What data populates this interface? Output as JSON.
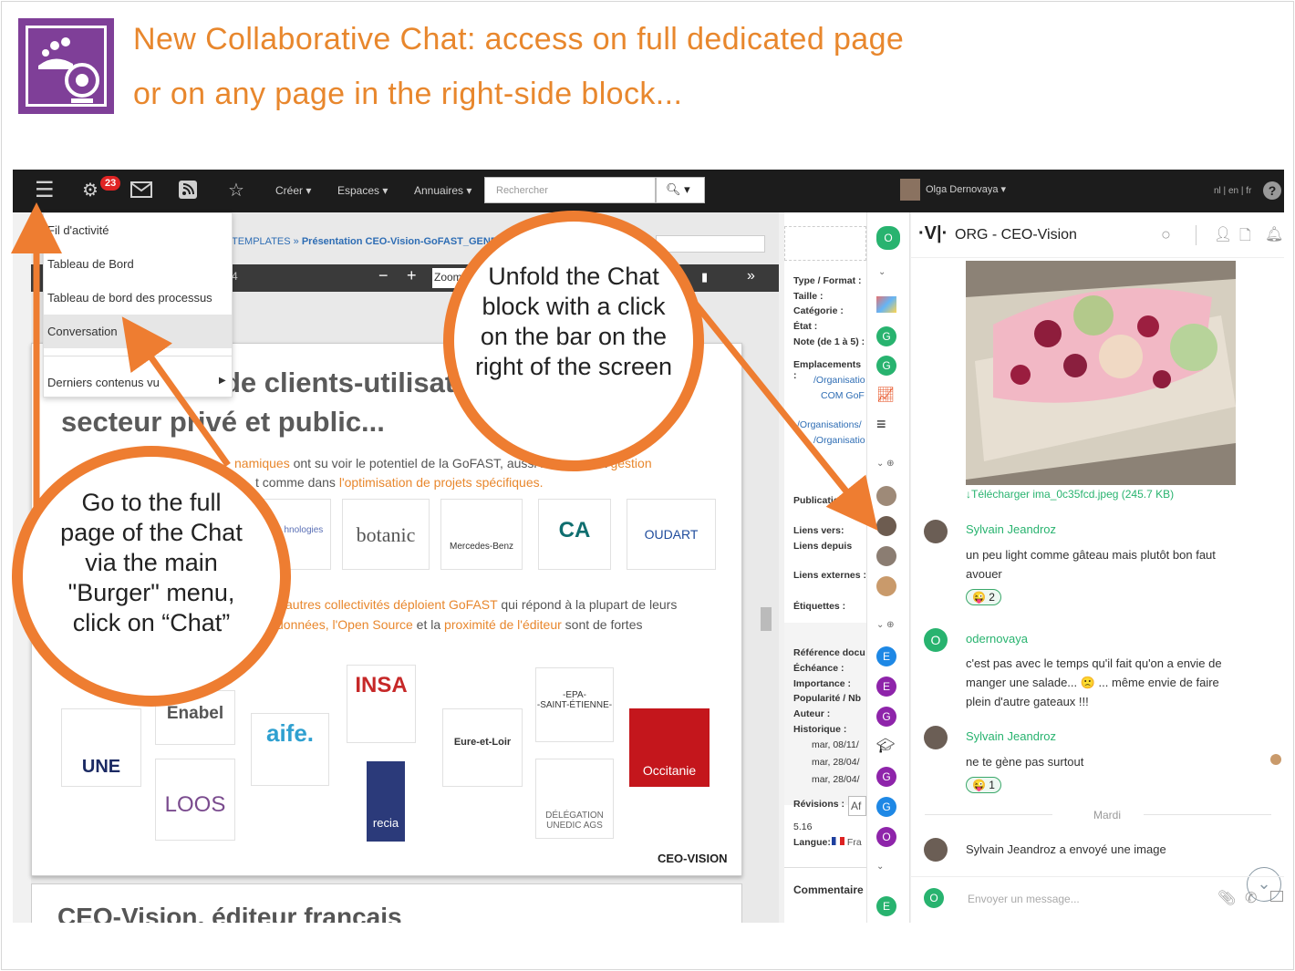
{
  "header": {
    "title_line1": "New Collaborative Chat: access on full dedicated page",
    "title_line2": "or on any page in the right-side block..."
  },
  "colors": {
    "accent": "#e8872d",
    "arrow": "#ee7d31",
    "brand_purple": "#7f3f98",
    "chat_green": "#28b36f"
  },
  "topbar": {
    "notification_count": "23",
    "menus": [
      "Créer",
      "Espaces",
      "Annuaires"
    ],
    "search_placeholder": "Rechercher",
    "user_name": "Olga Dernovaya",
    "languages": "nl | en | fr",
    "help": "?"
  },
  "burger_menu": {
    "items": [
      "Fil d'activité",
      "Tableau de Bord",
      "Tableau de bord des processus",
      "Conversation",
      "Derniers contenus vu"
    ]
  },
  "breadcrumb": {
    "parent": "TEMPLATES »",
    "current": "Présentation CEO-Vision-GoFAST_GENE"
  },
  "viewer": {
    "zoom_label": "Zoom",
    "page_hint": "4",
    "minus": "−",
    "plus": "+"
  },
  "slide": {
    "heading1": "de clients-utilisat",
    "heading2": "secteur privé et public...",
    "para1_accent": "namiques",
    "para1": "ont su voir le potentiel de la GoFAST, aussi bien pour la",
    "para1_accent2": "gestion",
    "para1_line2": "t comme dans",
    "para1_accent3": "l'optimisation de projets spécifiques.",
    "para2_accent": "autres collectivités déploient GoFAST",
    "para2": "qui répond à la plupart de leurs",
    "para2_accent2": "données, l'Open Source",
    "para2_mid": "et la",
    "para2_accent3": "proximité de l'éditeur",
    "para2_end": "sont de fortes",
    "logos_row1": [
      "blic\nhnologies",
      "botanic",
      "Mercedes-Benz",
      "CA",
      "OUDART"
    ],
    "logos_row2": [
      "UNE",
      "Enabel",
      "aife.",
      "LOOS",
      "INSA",
      "recia",
      "Eure-et-Loir",
      "-EPA-\n-SAINT-ÉTIENNE-",
      "DÉLÉGATION\nUNEDIC AGS",
      "Occitanie"
    ],
    "footer_brand": "CEO-VISION",
    "next_heading": "CEO-Vision, éditeur français"
  },
  "info_panel": {
    "labels": [
      "Type / Format :",
      "Taille :",
      "Catégorie :",
      "État :",
      "Note (de 1 à 5) :",
      "Emplacements :",
      "/Organisatio",
      "COM GoF",
      "/Organisations/",
      "/Organisatio",
      "Publication",
      "Liens vers:",
      "Liens depuis",
      "Liens externes :",
      "Étiquettes :",
      "Référence docu",
      "Échéance :",
      "Importance :",
      "Popularité / Nb",
      "Auteur :",
      "Historique :",
      "mar, 08/11/",
      "mar, 28/04/",
      "mar, 28/04/",
      "Révisions :",
      "5.16",
      "Langue:",
      "Commentaire"
    ],
    "revision_btn": "Af",
    "lang_value": "Fra"
  },
  "chat_rail": {
    "avatars": [
      {
        "letter": "O",
        "color": "#28b36f"
      },
      {
        "letter": "G",
        "color": "#28b36f"
      },
      {
        "letter": "G",
        "color": "#28b36f"
      },
      {
        "letter": "E",
        "color": "#1e88e5"
      },
      {
        "letter": "E",
        "color": "#8e24aa"
      },
      {
        "letter": "G",
        "color": "#8e24aa"
      },
      {
        "letter": "G",
        "color": "#8e24aa"
      },
      {
        "letter": "G",
        "color": "#1e88e5"
      },
      {
        "letter": "O",
        "color": "#8e24aa"
      },
      {
        "letter": "E",
        "color": "#28b36f"
      }
    ]
  },
  "chat": {
    "room_title": "ORG - CEO-Vision",
    "download_link": "↓Télécharger ima_0c35fcd.jpeg (245.7 KB)",
    "messages": [
      {
        "author": "Sylvain Jeandroz",
        "text": "un peu light comme gâteau mais plutôt bon faut avouer",
        "reaction": "2"
      },
      {
        "author": "odernovaya",
        "text": "c'est pas avec le temps qu'il fait qu'on a envie de manger une salade... 🙁 ... même envie de faire plein d'autre gateaux !!!",
        "reaction": ""
      },
      {
        "author": "Sylvain Jeandroz",
        "text": "ne te gène pas surtout",
        "reaction": "1"
      }
    ],
    "day_separator": "Mardi",
    "last_event": "Sylvain Jeandroz a envoyé une image",
    "composer_placeholder": "Envoyer un message...",
    "composer_avatar": "O"
  },
  "callouts": {
    "unfold": "Unfold the Chat block with a click on the bar on the right of the screen",
    "full_page": "Go to the full page of the Chat via the main \"Burger\" menu, click on “Chat”"
  }
}
